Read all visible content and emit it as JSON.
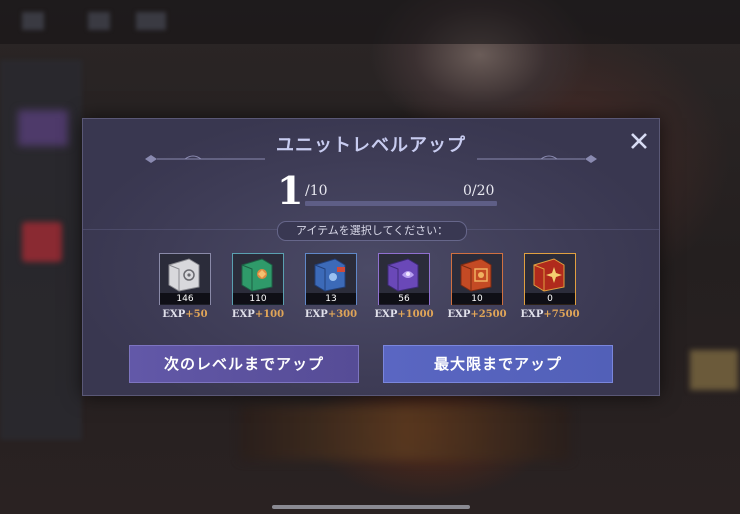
{
  "dialog": {
    "title": "ユニットレベルアップ",
    "level": {
      "current": "1",
      "max_label": "/10"
    },
    "exp": {
      "label": "0/20",
      "progress": 0
    },
    "prompt": "アイテムを選択してください：",
    "items": [
      {
        "icon": "white-book-icon",
        "count": "146",
        "exp_prefix": "EXP",
        "exp_value": "+50",
        "frame": "#8a8aa8"
      },
      {
        "icon": "green-book-icon",
        "count": "110",
        "exp_prefix": "EXP",
        "exp_value": "+100",
        "frame": "#5aa0b0"
      },
      {
        "icon": "blue-book-icon",
        "count": "13",
        "exp_prefix": "EXP",
        "exp_value": "+300",
        "frame": "#6088c8"
      },
      {
        "icon": "purple-book-icon",
        "count": "56",
        "exp_prefix": "EXP",
        "exp_value": "+1000",
        "frame": "#9070d0"
      },
      {
        "icon": "orange-book-icon",
        "count": "10",
        "exp_prefix": "EXP",
        "exp_value": "+2500",
        "frame": "#d07040"
      },
      {
        "icon": "gold-book-icon",
        "count": "0",
        "exp_prefix": "EXP",
        "exp_value": "+7500",
        "frame": "#e0a040"
      }
    ],
    "buttons": {
      "next_level": "次のレベルまでアップ",
      "max_level": "最大限までアップ"
    }
  },
  "colors": {
    "exp_bonus": "#e0a558",
    "accent_next": "#6258a8",
    "accent_max": "#5a66c2"
  }
}
